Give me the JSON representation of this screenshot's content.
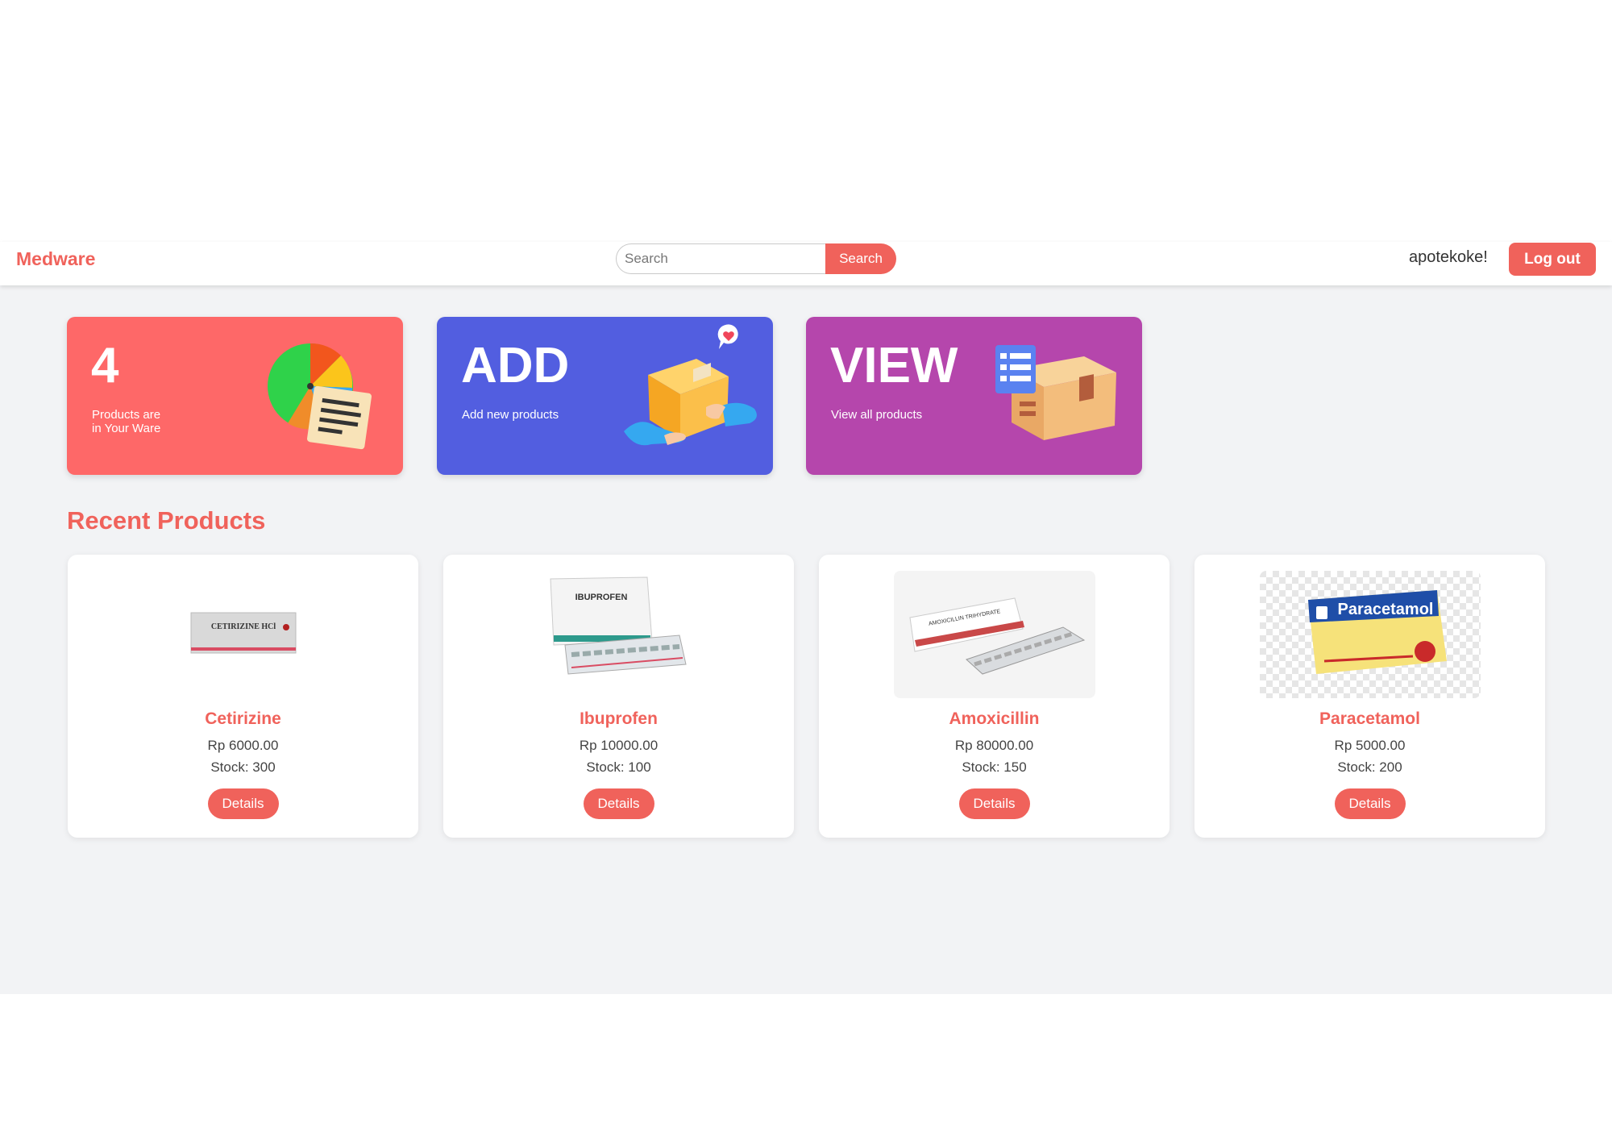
{
  "navbar": {
    "brand": "Medware",
    "search_placeholder": "Search",
    "search_button": "Search",
    "username": "apotekoke!",
    "logout_button": "Log out"
  },
  "stats": {
    "count": {
      "value": "4",
      "label_line1": "Products are",
      "label_line2": "in Your Ware",
      "color": "#fe6868",
      "icon": "pie-chart-document-icon"
    },
    "add": {
      "value": "ADD",
      "label": "Add new products",
      "color": "#525ee0",
      "icon": "box-delivery-icon"
    },
    "view": {
      "value": "VIEW",
      "label": "View all products",
      "color": "#b546ac",
      "icon": "box-checklist-icon"
    }
  },
  "section_title": "Recent Products",
  "products": [
    {
      "name": "Cetirizine",
      "price": "Rp 6000.00",
      "stock": "Stock: 300",
      "button": "Details",
      "image_label": "CETIRIZINE HCl"
    },
    {
      "name": "Ibuprofen",
      "price": "Rp 10000.00",
      "stock": "Stock: 100",
      "button": "Details",
      "image_label": "IBUPROFEN"
    },
    {
      "name": "Amoxicillin",
      "price": "Rp 80000.00",
      "stock": "Stock: 150",
      "button": "Details",
      "image_label": "AMOXICILLIN TRIHYDRATE"
    },
    {
      "name": "Paracetamol",
      "price": "Rp 5000.00",
      "stock": "Stock: 200",
      "button": "Details",
      "image_label": "Paracetamol"
    }
  ],
  "annotation": {
    "arrow_color": "#0b4fa8"
  },
  "colors": {
    "accent": "#f0625b",
    "page_bg": "#f2f3f5"
  }
}
